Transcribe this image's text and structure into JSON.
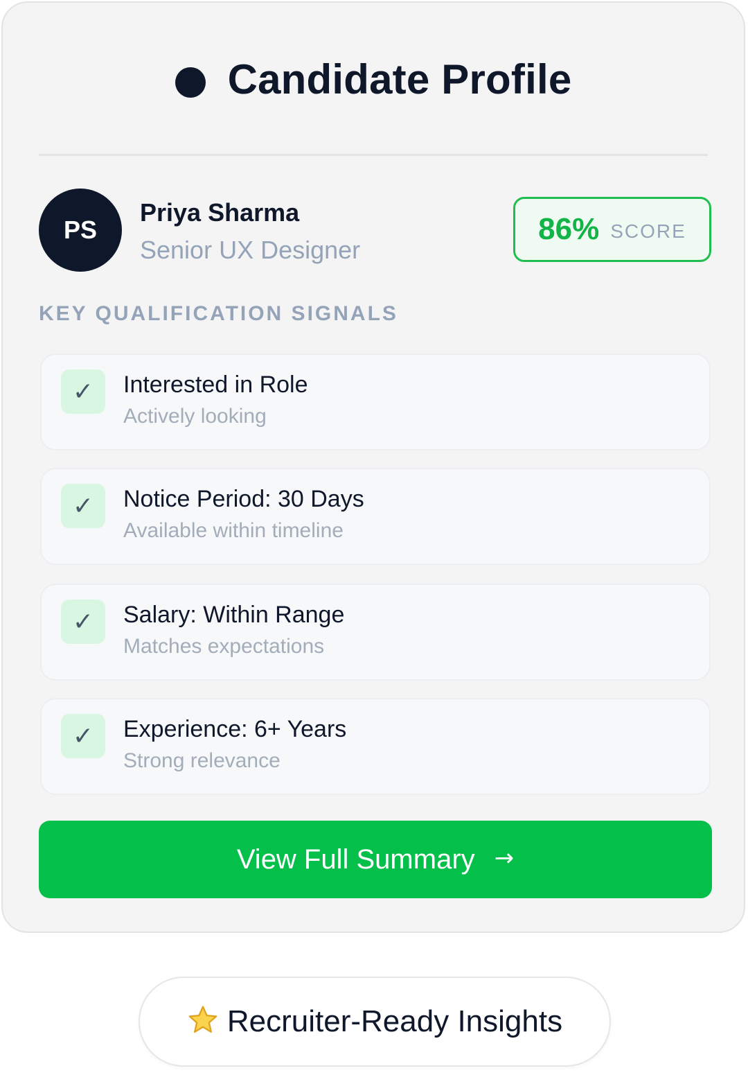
{
  "header": {
    "title": "Candidate Profile",
    "icon": "dot-icon"
  },
  "candidate": {
    "initials": "PS",
    "name": "Priya Sharma",
    "role": "Senior UX Designer",
    "score_value": "86%",
    "score_label": "SCORE"
  },
  "signals_section": {
    "title": "KEY QUALIFICATION SIGNALS",
    "items": [
      {
        "check": "✓",
        "title": "Interested in Role",
        "subtitle": "Actively looking"
      },
      {
        "check": "✓",
        "title": "Notice Period: 30 Days",
        "subtitle": "Available within timeline"
      },
      {
        "check": "✓",
        "title": "Salary: Within Range",
        "subtitle": "Matches expectations"
      },
      {
        "check": "✓",
        "title": "Experience: 6+ Years",
        "subtitle": "Strong relevance"
      }
    ]
  },
  "cta": {
    "label": "View Full Summary",
    "arrow": "→"
  },
  "footer_pill": {
    "label": "Recruiter-Ready Insights",
    "icon": "star-icon"
  },
  "colors": {
    "accent_green": "#04c04b",
    "score_green": "#12b347",
    "check_bg": "#d9f6e3",
    "text_dark": "#0f172a",
    "text_muted": "#94a3b8"
  }
}
